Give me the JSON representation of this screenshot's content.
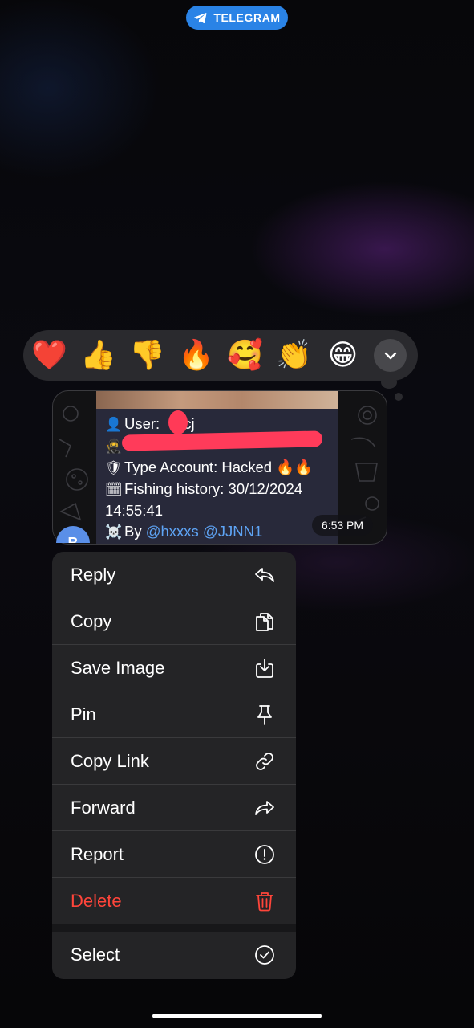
{
  "top_badge": {
    "label": "TELEGRAM",
    "icon": "telegram-plane-icon",
    "color": "#2a83e6"
  },
  "reactions": {
    "items": [
      {
        "emoji": "❤️",
        "icon": "heart-emoji"
      },
      {
        "emoji": "👍",
        "icon": "thumbs-up-emoji"
      },
      {
        "emoji": "👎",
        "icon": "thumbs-down-emoji"
      },
      {
        "emoji": "🔥",
        "icon": "fire-emoji"
      },
      {
        "emoji": "🥰",
        "icon": "smiling-face-hearts-emoji"
      },
      {
        "emoji": "👏",
        "icon": "clapping-hands-emoji"
      },
      {
        "emoji": "😁",
        "icon": "grinning-face-emoji"
      }
    ],
    "more_icon": "chevron-down-icon"
  },
  "message": {
    "line1_icon": "👤",
    "line1_label": "User:",
    "line1_value_visible": "cj",
    "line2_icon": "🥷",
    "line3_icon": "🛡",
    "line3_text": "Type Account: Hacked 🔥🔥",
    "line4_icon": "🗓",
    "line4_text": "Fishing history: 30/12/2024",
    "line5_text": "14:55:41",
    "line6_icon": "☠️",
    "line6_by": "By",
    "mention1": "@hxxxs",
    "mention2": "@JJNN1",
    "time": "6:53 PM",
    "avatar_initial": "B",
    "redaction_color": "#ff3b5a"
  },
  "context_menu": {
    "reply": "Reply",
    "copy": "Copy",
    "save_image": "Save Image",
    "pin": "Pin",
    "copy_link": "Copy Link",
    "forward": "Forward",
    "report": "Report",
    "delete": "Delete",
    "select": "Select",
    "delete_color": "#ff453a"
  }
}
